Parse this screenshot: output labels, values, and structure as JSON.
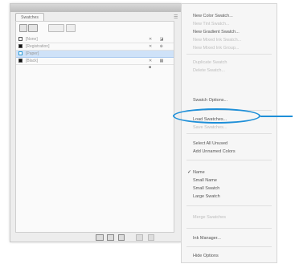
{
  "panel": {
    "tab_label": "Swatches",
    "swatches": [
      {
        "name": "[None]",
        "color": "white",
        "icons": "✕ ◪",
        "selected": false
      },
      {
        "name": "[Registration]",
        "color": "black",
        "icons": "✕ ⊕",
        "selected": false
      },
      {
        "name": "[Paper]",
        "color": "white",
        "icons": "",
        "selected": true
      },
      {
        "name": "[Black]",
        "color": "black",
        "icons": "✕ ▦ ■",
        "selected": false
      }
    ]
  },
  "menu": {
    "items": [
      {
        "label": "New Color Swatch...",
        "disabled": false,
        "checked": false
      },
      {
        "label": "New Tint Swatch...",
        "disabled": true,
        "checked": false
      },
      {
        "label": "New Gradient Swatch...",
        "disabled": false,
        "checked": false
      },
      {
        "label": "New Mixed Ink Swatch...",
        "disabled": true,
        "checked": false
      },
      {
        "label": "New Mixed Ink Group...",
        "disabled": true,
        "checked": false
      },
      {
        "label": "Duplicate Swatch",
        "disabled": true,
        "checked": false
      },
      {
        "label": "Delete Swatch...",
        "disabled": true,
        "checked": false
      },
      {
        "label": "Swatch Options...",
        "disabled": false,
        "checked": false
      },
      {
        "label": "Load Swatches...",
        "disabled": false,
        "checked": false
      },
      {
        "label": "Save Swatches...",
        "disabled": true,
        "checked": false
      },
      {
        "label": "Select All Unused",
        "disabled": false,
        "checked": false
      },
      {
        "label": "Add Unnamed Colors",
        "disabled": false,
        "checked": false
      },
      {
        "label": "Name",
        "disabled": false,
        "checked": true
      },
      {
        "label": "Small Name",
        "disabled": false,
        "checked": false
      },
      {
        "label": "Small Swatch",
        "disabled": false,
        "checked": false
      },
      {
        "label": "Large Swatch",
        "disabled": false,
        "checked": false
      },
      {
        "label": "Merge Swatches",
        "disabled": true,
        "checked": false
      },
      {
        "label": "Ink Manager...",
        "disabled": false,
        "checked": false
      },
      {
        "label": "Hide Options",
        "disabled": false,
        "checked": false
      }
    ]
  },
  "callout": {
    "color": "#1e8fd8"
  }
}
